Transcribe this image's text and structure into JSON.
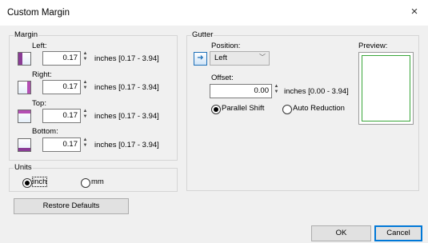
{
  "window": {
    "title": "Custom Margin",
    "close_glyph": "×"
  },
  "margin": {
    "group_label": "Margin",
    "left": {
      "label": "Left:",
      "value": "0.17",
      "range": "inches [0.17 - 3.94]",
      "icon": "margin-left-icon"
    },
    "right": {
      "label": "Right:",
      "value": "0.17",
      "range": "inches [0.17 - 3.94]",
      "icon": "margin-right-icon"
    },
    "top": {
      "label": "Top:",
      "value": "0.17",
      "range": "inches [0.17 - 3.94]",
      "icon": "margin-top-icon"
    },
    "bottom": {
      "label": "Bottom:",
      "value": "0.17",
      "range": "inches [0.17 - 3.94]",
      "icon": "margin-bottom-icon"
    }
  },
  "units": {
    "group_label": "Units",
    "options": [
      "inch",
      "mm"
    ],
    "selected": "inch"
  },
  "gutter": {
    "group_label": "Gutter",
    "position_label": "Position:",
    "position_value": "Left",
    "offset_label": "Offset:",
    "offset_value": "0.00",
    "offset_range": "inches [0.00 - 3.94]",
    "mode_options": [
      "Parallel Shift",
      "Auto Reduction"
    ],
    "mode_selected": "Parallel Shift"
  },
  "preview": {
    "label": "Preview:"
  },
  "buttons": {
    "restore_defaults": "Restore Defaults",
    "ok": "OK",
    "cancel": "Cancel"
  },
  "colors": {
    "margin_left_band": "#8a3c96",
    "margin_right_band": "#b44fb4",
    "margin_top_band": "#b44fb4",
    "margin_bottom_band": "#8a3c96",
    "preview_border": "#3aa63a",
    "default_button_border": "#0078d7"
  }
}
